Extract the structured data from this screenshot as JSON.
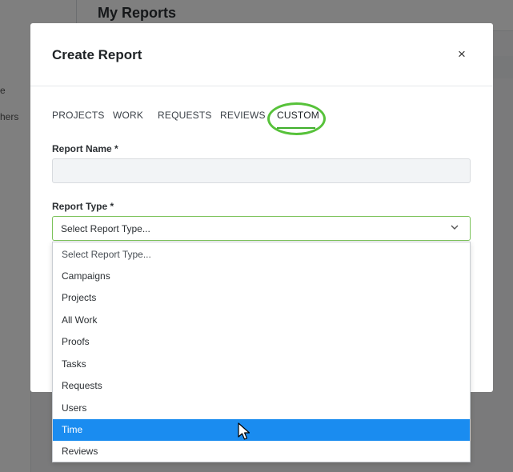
{
  "background": {
    "page_title": "My Reports",
    "side_text_1": "e",
    "side_text_2": "hers"
  },
  "modal": {
    "title": "Create Report",
    "close_label": "×",
    "tabs": [
      {
        "label": "PROJECTS",
        "active": false
      },
      {
        "label": "WORK",
        "active": false
      },
      {
        "label": "REQUESTS",
        "active": false
      },
      {
        "label": "REVIEWS",
        "active": false
      },
      {
        "label": "CUSTOM",
        "active": true
      }
    ],
    "report_name": {
      "label": "Report Name *",
      "value": ""
    },
    "report_type": {
      "label": "Report Type *",
      "selected_value": "Select Report Type...",
      "options": [
        "Select Report Type...",
        "Campaigns",
        "Projects",
        "All Work",
        "Proofs",
        "Tasks",
        "Requests",
        "Users",
        "Time",
        "Reviews"
      ],
      "highlighted_option": "Time"
    }
  },
  "colors": {
    "accent_green": "#3fae2a",
    "highlight_circle": "#57c23a",
    "selected_blue": "#1a8cf0",
    "overlay": "rgba(0,0,0,0.5)"
  },
  "icons": {
    "close": "close-icon",
    "chevron": "chevron-down-icon",
    "cursor": "mouse-pointer-icon"
  }
}
